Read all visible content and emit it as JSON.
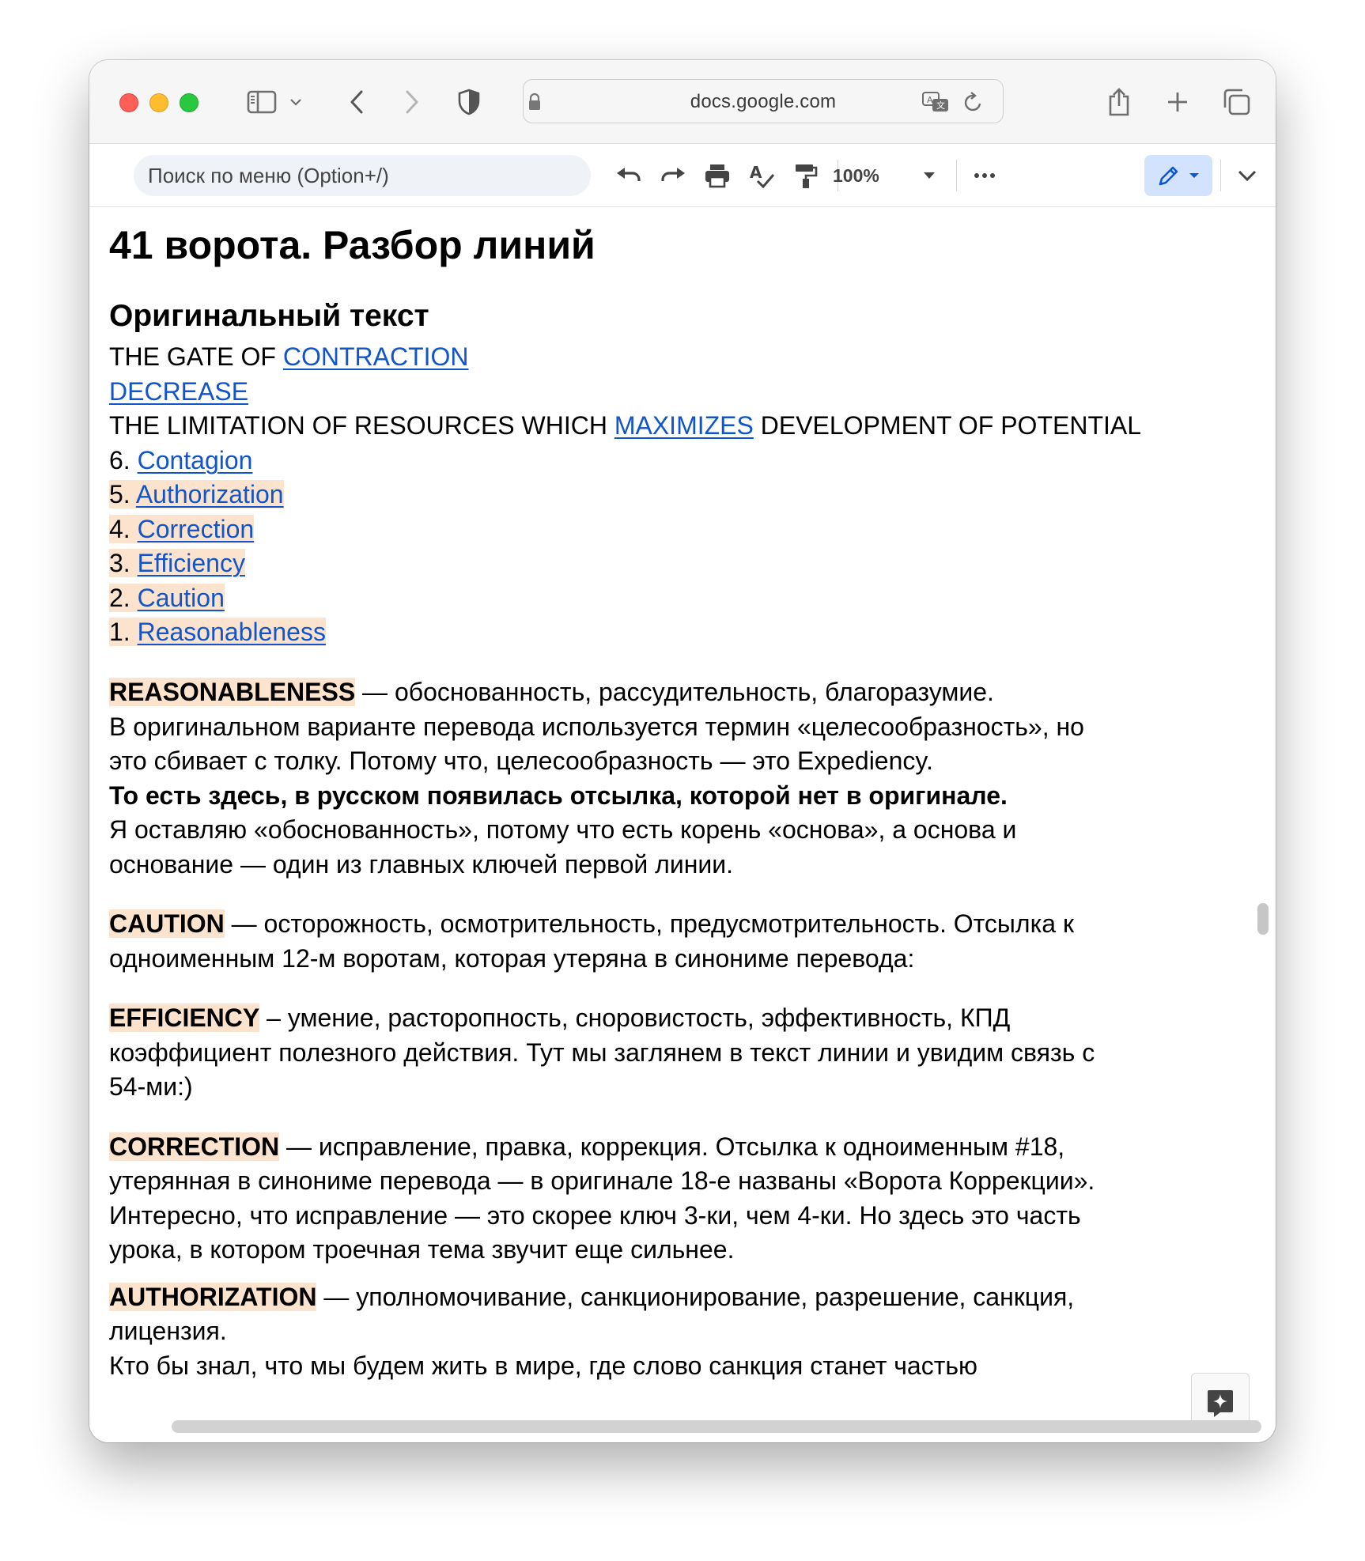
{
  "browser": {
    "url": "docs.google.com"
  },
  "toolbar": {
    "menu_search_placeholder": "Поиск по меню (Option+/)",
    "zoom": "100%"
  },
  "document": {
    "title": "41 ворота. Разбор линий",
    "section_heading": "Оригинальный текст",
    "original": {
      "gate_prefix": "THE GATE OF ",
      "gate_link": "CONTRACTION",
      "decrease_link": "DECREASE",
      "limitation_prefix": "THE LIMITATION OF RESOURCES WHICH ",
      "limitation_link": "MAXIMIZES",
      "limitation_suffix": " DEVELOPMENT OF POTENTIAL",
      "lines": [
        {
          "num": "6. ",
          "name": "Contagion"
        },
        {
          "num": "5. ",
          "name": "Authorization"
        },
        {
          "num": "4. ",
          "name": "Correction"
        },
        {
          "num": "3. ",
          "name": "Efficiency"
        },
        {
          "num": "2. ",
          "name": "Caution"
        },
        {
          "num": "1. ",
          "name": "Reasonableness"
        }
      ]
    },
    "reasonableness": {
      "term": "REASONABLENESS",
      "l1": " — обоснованность, рассудительность, благоразумие.",
      "l2": "В оригинальном варианте перевода используется термин «целесообразность», но",
      "l3": "это сбивает с толку. Потому что, целесообразность — это Expediency.",
      "l4": "То есть здесь, в русском появилась отсылка, которой нет в оригинале.",
      "l5": "Я оставляю «обоснованность», потому что есть корень «основа», а основа и",
      "l6": "основание — один из главных ключей первой линии."
    },
    "caution": {
      "term": "CAUTION",
      "l1": " — осторожность, осмотрительность, предусмотрительность. Отсылка к",
      "l2": "одноименным 12-м воротам, которая утеряна в синониме перевода:"
    },
    "efficiency": {
      "term": "EFFICIENCY",
      "l1": " – умение, расторопность, сноровистость, эффективность, КПД",
      "l2": "коэффициент полезного действия. Тут мы заглянем в текст линии и увидим связь с",
      "l3": "54-ми:)"
    },
    "correction": {
      "term": "CORRECTION",
      "l1": " — исправление, правка, коррекция. Отсылка к одноименным #18,",
      "l2": "утерянная в синониме перевода — в оригинале 18-е названы «Ворота Коррекции».",
      "l3": "Интересно, что исправление — это скорее ключ 3-ки, чем 4-ки. Но здесь это часть",
      "l4": "урока, в котором троечная тема звучит еще сильнее."
    },
    "authorization": {
      "term": "AUTHORIZATION",
      "l1": " — уполномочивание, санкционирование, разрешение, санкция,",
      "l2": "лицензия.",
      "l3": "Кто бы знал, что мы будем жить в мире, где слово санкция станет частью"
    }
  },
  "colors": {
    "link": "#1155cc",
    "highlight": "#fce3cd",
    "edit_mode_bg": "#d3e3fd"
  },
  "icons": [
    "sidebar-icon",
    "chevron-down-icon",
    "back-icon",
    "forward-icon",
    "shield-icon",
    "lock-icon",
    "translate-icon",
    "reload-icon",
    "share-icon",
    "plus-icon",
    "tabs-icon",
    "undo-icon",
    "redo-icon",
    "print-icon",
    "spellcheck-icon",
    "paint-format-icon",
    "more-icon",
    "pencil-icon",
    "gemini-icon"
  ]
}
